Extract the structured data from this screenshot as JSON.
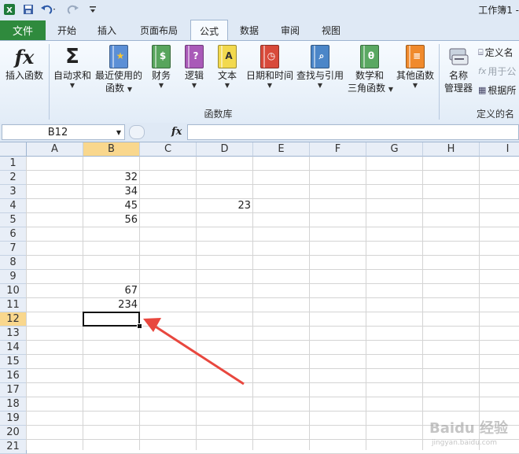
{
  "title_bar": {
    "document_title": "工作簿1 -"
  },
  "qat": {
    "icons": [
      "excel-logo-icon",
      "save-icon",
      "undo-icon",
      "redo-icon",
      "customize-icon"
    ]
  },
  "tabs": {
    "file": "文件",
    "items": [
      {
        "label": "开始",
        "active": false
      },
      {
        "label": "插入",
        "active": false
      },
      {
        "label": "页面布局",
        "active": false
      },
      {
        "label": "公式",
        "active": true
      },
      {
        "label": "数据",
        "active": false
      },
      {
        "label": "审阅",
        "active": false
      },
      {
        "label": "视图",
        "active": false
      }
    ]
  },
  "ribbon": {
    "group_label": "函数库",
    "group_label_2": "定义的名",
    "insert_function": "插入函数",
    "autosum": "自动求和",
    "recent_1": "最近使用的",
    "recent_2": "函数",
    "financial": "财务",
    "logical": "逻辑",
    "text": "文本",
    "datetime": "日期和时间",
    "lookup": "查找与引用",
    "math_1": "数学和",
    "math_2": "三角函数",
    "other": "其他函数",
    "name_mgr_1": "名称",
    "name_mgr_2": "管理器",
    "define_name": "定义名",
    "use_in_formula": "用于公",
    "create_from": "根据所"
  },
  "formula_bar": {
    "name_box": "B12",
    "fx": "fx",
    "formula": ""
  },
  "grid": {
    "columns": [
      "A",
      "B",
      "C",
      "D",
      "E",
      "F",
      "G",
      "H",
      "I"
    ],
    "rows": [
      "1",
      "2",
      "3",
      "4",
      "5",
      "6",
      "7",
      "8",
      "9",
      "10",
      "11",
      "12",
      "13",
      "14",
      "15",
      "16",
      "17",
      "18",
      "19",
      "20",
      "21"
    ],
    "selected_cell": "B12",
    "cells": {
      "B2": "32",
      "B3": "34",
      "B4": "45",
      "B5": "56",
      "D4": "23",
      "B10": "67",
      "B11": "234"
    }
  },
  "watermark": {
    "main": "Baidu 经验",
    "sub": "jingyan.baidu.com"
  },
  "colors": {
    "file_tab": "#2f8a3d",
    "selection_header": "#f9d78d",
    "arrow": "#e8473e"
  }
}
